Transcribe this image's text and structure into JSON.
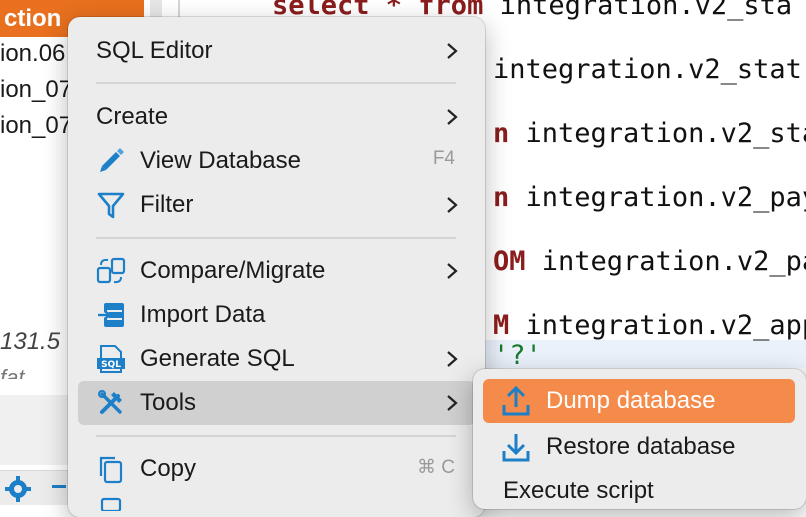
{
  "navigator": {
    "selected_label": "ction",
    "items": [
      "ion.06",
      "ion_07",
      "ion_07"
    ],
    "number_text": "131.5",
    "fragment_text": "fat"
  },
  "editor": {
    "lines": [
      {
        "kw": "select * from",
        "rest": " integration.v2_sta"
      },
      {
        "kw": "",
        "rest": "integration.v2_stat"
      },
      {
        "kw": "n",
        "rest": " integration.v2_sta"
      },
      {
        "kw": "n",
        "rest": " integration.v2_pay"
      },
      {
        "kw": "OM",
        "rest": " integration.v2_pa"
      },
      {
        "kw": "M",
        "rest": " integration.v2_app"
      },
      {
        "kw": "",
        "rest": "'?'"
      }
    ]
  },
  "context_menu": {
    "items": [
      {
        "label": "SQL Editor"
      },
      {
        "label": "Create"
      },
      {
        "label": "View Database",
        "shortcut": "F4"
      },
      {
        "label": "Filter"
      },
      {
        "label": "Compare/Migrate"
      },
      {
        "label": "Import Data"
      },
      {
        "label": "Generate SQL"
      },
      {
        "label": "Tools"
      },
      {
        "label": "Copy",
        "shortcut": "⌘ C"
      }
    ]
  },
  "submenu": {
    "items": [
      {
        "label": "Dump database"
      },
      {
        "label": "Restore database"
      },
      {
        "label": "Execute script"
      }
    ]
  },
  "colors": {
    "accent": "#f48b4a",
    "nav_selected": "#e8701e",
    "icon_blue": "#1d7fc8"
  }
}
